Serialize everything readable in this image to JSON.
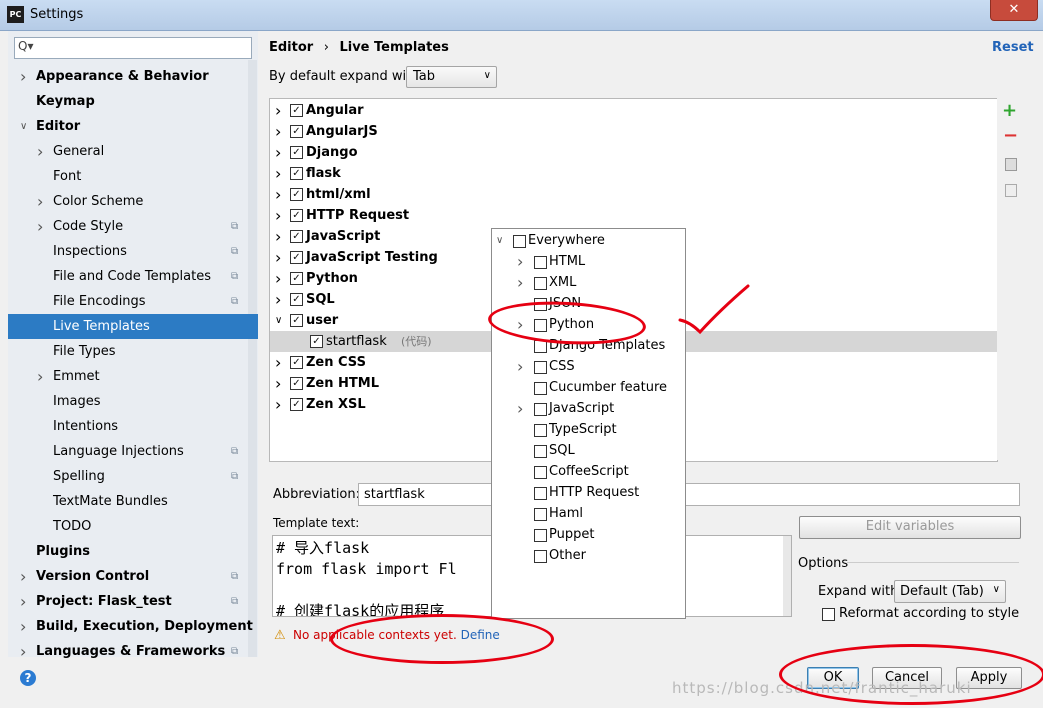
{
  "window": {
    "title": "Settings",
    "app_icon": "PC",
    "close": "✕"
  },
  "search": {
    "placeholder": "",
    "icon": "Q▾"
  },
  "nav": {
    "items": [
      {
        "label": "Appearance & Behavior",
        "bold": true,
        "arrow": "right",
        "indent": 0
      },
      {
        "label": "Keymap",
        "bold": true,
        "arrow": "",
        "indent": 0
      },
      {
        "label": "Editor",
        "bold": true,
        "arrow": "down",
        "indent": 0
      },
      {
        "label": "General",
        "bold": false,
        "arrow": "right",
        "indent": 1
      },
      {
        "label": "Font",
        "bold": false,
        "arrow": "",
        "indent": 1
      },
      {
        "label": "Color Scheme",
        "bold": false,
        "arrow": "right",
        "indent": 1
      },
      {
        "label": "Code Style",
        "bold": false,
        "arrow": "right",
        "indent": 1,
        "copy": true
      },
      {
        "label": "Inspections",
        "bold": false,
        "arrow": "",
        "indent": 1,
        "copy": true
      },
      {
        "label": "File and Code Templates",
        "bold": false,
        "arrow": "",
        "indent": 1,
        "copy": true
      },
      {
        "label": "File Encodings",
        "bold": false,
        "arrow": "",
        "indent": 1,
        "copy": true
      },
      {
        "label": "Live Templates",
        "bold": false,
        "arrow": "",
        "indent": 1,
        "selected": true
      },
      {
        "label": "File Types",
        "bold": false,
        "arrow": "",
        "indent": 1
      },
      {
        "label": "Emmet",
        "bold": false,
        "arrow": "right",
        "indent": 1
      },
      {
        "label": "Images",
        "bold": false,
        "arrow": "",
        "indent": 1
      },
      {
        "label": "Intentions",
        "bold": false,
        "arrow": "",
        "indent": 1
      },
      {
        "label": "Language Injections",
        "bold": false,
        "arrow": "",
        "indent": 1,
        "copy": true
      },
      {
        "label": "Spelling",
        "bold": false,
        "arrow": "",
        "indent": 1,
        "copy": true
      },
      {
        "label": "TextMate Bundles",
        "bold": false,
        "arrow": "",
        "indent": 1
      },
      {
        "label": "TODO",
        "bold": false,
        "arrow": "",
        "indent": 1
      },
      {
        "label": "Plugins",
        "bold": true,
        "arrow": "",
        "indent": 0
      },
      {
        "label": "Version Control",
        "bold": true,
        "arrow": "right",
        "indent": 0,
        "copy": true
      },
      {
        "label": "Project: Flask_test",
        "bold": true,
        "arrow": "right",
        "indent": 0,
        "copy": true
      },
      {
        "label": "Build, Execution, Deployment",
        "bold": true,
        "arrow": "right",
        "indent": 0
      },
      {
        "label": "Languages & Frameworks",
        "bold": true,
        "arrow": "right",
        "indent": 0,
        "copy": true
      }
    ]
  },
  "header": {
    "crumb_editor": "Editor",
    "crumb_sep": "›",
    "crumb_page": "Live Templates",
    "reset": "Reset"
  },
  "expand": {
    "label": "By default expand with",
    "value": "Tab"
  },
  "templates": [
    {
      "label": "Angular",
      "checked": true,
      "expanded": false
    },
    {
      "label": "AngularJS",
      "checked": true,
      "expanded": false
    },
    {
      "label": "Django",
      "checked": true,
      "expanded": false
    },
    {
      "label": "flask",
      "checked": true,
      "expanded": false
    },
    {
      "label": "html/xml",
      "checked": true,
      "expanded": false
    },
    {
      "label": "HTTP Request",
      "checked": true,
      "expanded": false
    },
    {
      "label": "JavaScript",
      "checked": true,
      "expanded": false
    },
    {
      "label": "JavaScript Testing",
      "checked": true,
      "expanded": false
    },
    {
      "label": "Python",
      "checked": true,
      "expanded": false
    },
    {
      "label": "SQL",
      "checked": true,
      "expanded": false
    },
    {
      "label": "user",
      "checked": true,
      "expanded": true
    },
    {
      "label": "startflask",
      "sub": "(代码)",
      "checked": true,
      "child": true
    },
    {
      "label": "Zen CSS",
      "checked": true,
      "expanded": false
    },
    {
      "label": "Zen HTML",
      "checked": true,
      "expanded": false
    },
    {
      "label": "Zen XSL",
      "checked": true,
      "expanded": false
    }
  ],
  "side_toolbar": {
    "add": "+",
    "remove": "−"
  },
  "contexts": [
    {
      "label": "Everywhere",
      "arrow": "down",
      "indent": 0
    },
    {
      "label": "HTML",
      "arrow": "right",
      "indent": 1
    },
    {
      "label": "XML",
      "arrow": "right",
      "indent": 1
    },
    {
      "label": "JSON",
      "arrow": "",
      "indent": 1
    },
    {
      "label": "Python",
      "arrow": "right",
      "indent": 1
    },
    {
      "label": "Django Templates",
      "arrow": "",
      "indent": 1
    },
    {
      "label": "CSS",
      "arrow": "right",
      "indent": 1
    },
    {
      "label": "Cucumber feature",
      "arrow": "",
      "indent": 1
    },
    {
      "label": "JavaScript",
      "arrow": "right",
      "indent": 1
    },
    {
      "label": "TypeScript",
      "arrow": "",
      "indent": 1
    },
    {
      "label": "SQL",
      "arrow": "",
      "indent": 1
    },
    {
      "label": "CoffeeScript",
      "arrow": "",
      "indent": 1
    },
    {
      "label": "HTTP Request",
      "arrow": "",
      "indent": 1
    },
    {
      "label": "Haml",
      "arrow": "",
      "indent": 1
    },
    {
      "label": "Puppet",
      "arrow": "",
      "indent": 1
    },
    {
      "label": "Other",
      "arrow": "",
      "indent": 1
    }
  ],
  "abbreviation": {
    "label": "Abbreviation:",
    "value": "startflask"
  },
  "template_text": {
    "label": "Template text:",
    "lines": [
      "# 导入flask",
      "from flask import Fl",
      "",
      "# 创建flask的应用程序"
    ]
  },
  "edit_variables": "Edit variables",
  "options": {
    "title": "Options",
    "expand_label": "Expand with",
    "expand_value": "Default (Tab)",
    "reformat_label": "Reformat according to style"
  },
  "warning": {
    "text": "No applicable contexts yet.",
    "link": "Define"
  },
  "buttons": {
    "ok": "OK",
    "cancel": "Cancel",
    "apply": "Apply",
    "help": "?"
  },
  "watermark": "https://blog.csdn.net/frantic_haruki",
  "colors": {
    "selection": "#2c7bc4",
    "annotation_red": "#e60012",
    "link": "#2264b8"
  }
}
